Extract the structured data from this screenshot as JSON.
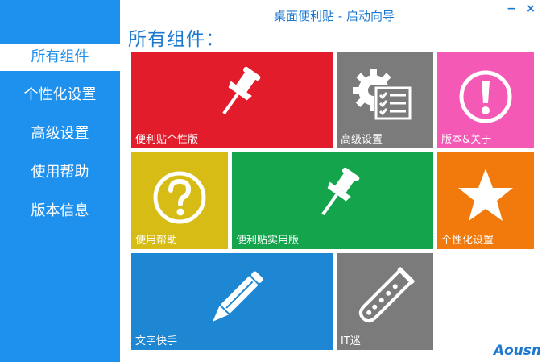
{
  "window": {
    "title": "桌面便利贴 - 启动向导",
    "minimize_label": "−",
    "close_label": "×"
  },
  "sidebar": {
    "items": [
      {
        "label": "所有组件",
        "active": true
      },
      {
        "label": "个性化设置",
        "active": false
      },
      {
        "label": "高级设置",
        "active": false
      },
      {
        "label": "使用帮助",
        "active": false
      },
      {
        "label": "版本信息",
        "active": false
      }
    ]
  },
  "main": {
    "heading": "所有组件："
  },
  "tiles": [
    {
      "label": "便利贴个性版",
      "color": "#e31c2c",
      "icon": "pushpin-icon"
    },
    {
      "label": "高级设置",
      "color": "#7b7b7b",
      "icon": "gear-checklist-icon"
    },
    {
      "label": "版本&关于",
      "color": "#f45ab5",
      "icon": "exclamation-icon"
    },
    {
      "label": "使用帮助",
      "color": "#d6bc14",
      "icon": "question-icon"
    },
    {
      "label": "便利贴实用版",
      "color": "#14a44c",
      "icon": "pushpin-icon"
    },
    {
      "label": "个性化设置",
      "color": "#f27a0c",
      "icon": "star-icon"
    },
    {
      "label": "文字快手",
      "color": "#1d87d4",
      "icon": "pencil-icon"
    },
    {
      "label": "IT迷",
      "color": "#7b7b7b",
      "icon": "test-tube-icon"
    }
  ],
  "logo": {
    "text": "Aousn"
  }
}
